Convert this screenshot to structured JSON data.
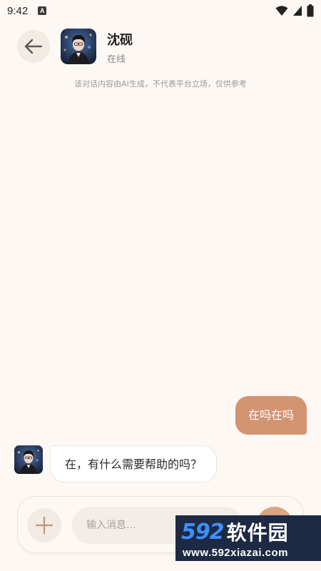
{
  "status_bar": {
    "time": "9:42",
    "notification_letter": "A",
    "icons": [
      "a-notification-icon",
      "wifi-icon",
      "battery-icon"
    ]
  },
  "header": {
    "contact_name": "沈砚",
    "contact_status": "在线",
    "disclaimer": "该对话内容由AI生成，不代表平台立场，仅供参考"
  },
  "messages": [
    {
      "role": "user",
      "text": "在吗在吗"
    },
    {
      "role": "assistant",
      "text": "在，有什么需要帮助的吗？"
    }
  ],
  "composer": {
    "placeholder": "输入消息...",
    "value": ""
  },
  "watermark": {
    "brand_number": "592",
    "brand_text": "软件园",
    "url": "www.592xiazai.com"
  },
  "colors": {
    "background": "#fdf8f3",
    "user_bubble": "#d39472",
    "send_button": "#dba483",
    "watermark_bg": "#1d2a44",
    "watermark_accent": "#3f8ff7"
  }
}
